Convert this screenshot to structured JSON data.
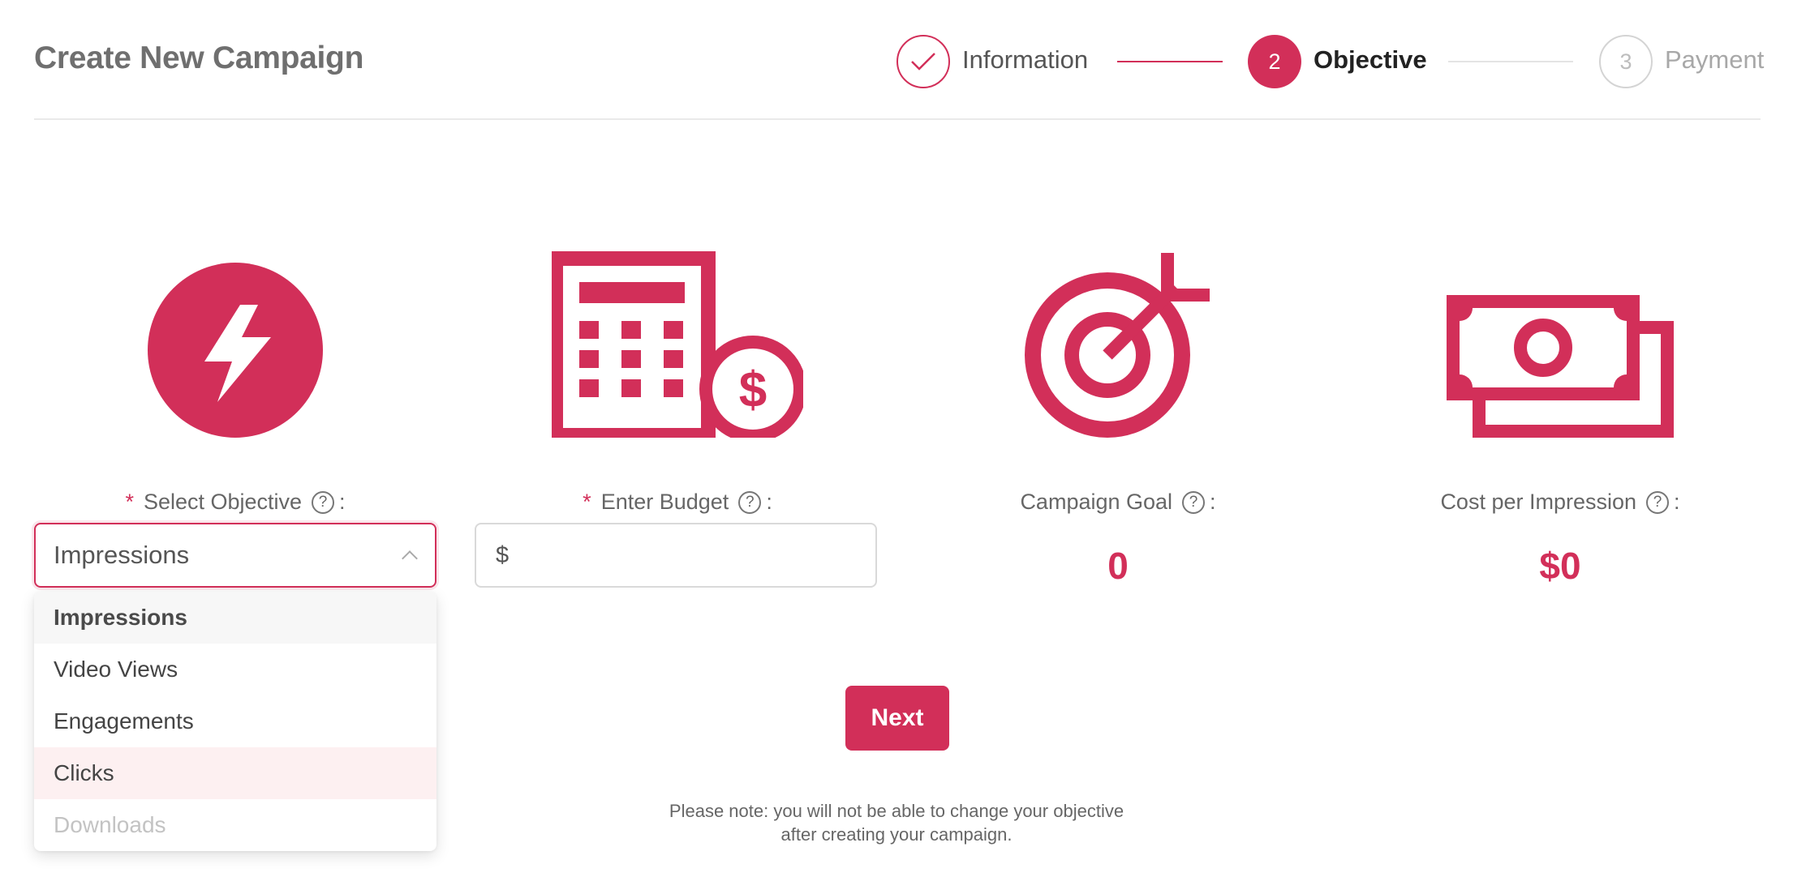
{
  "header": {
    "title": "Create New Campaign"
  },
  "steps": [
    {
      "number": "1",
      "label": "Information",
      "state": "done"
    },
    {
      "number": "2",
      "label": "Objective",
      "state": "active"
    },
    {
      "number": "3",
      "label": "Payment",
      "state": "pending"
    }
  ],
  "colors": {
    "accent": "#d22f59"
  },
  "objective": {
    "label": "Select Objective",
    "required_mark": "*",
    "selected": "Impressions",
    "options": [
      "Impressions",
      "Video Views",
      "Engagements",
      "Clicks",
      "Downloads"
    ]
  },
  "budget": {
    "label": "Enter Budget",
    "required_mark": "*",
    "prefix": "$",
    "value": ""
  },
  "goal": {
    "label": "Campaign Goal",
    "value": "0"
  },
  "cpi": {
    "label": "Cost per Impression",
    "value": "$0"
  },
  "help": {
    "glyph": "?",
    "suffix": ":"
  },
  "next_label": "Next",
  "note": {
    "line1": "Please note: you will not be able to change your objective",
    "line2": "after creating your campaign."
  }
}
